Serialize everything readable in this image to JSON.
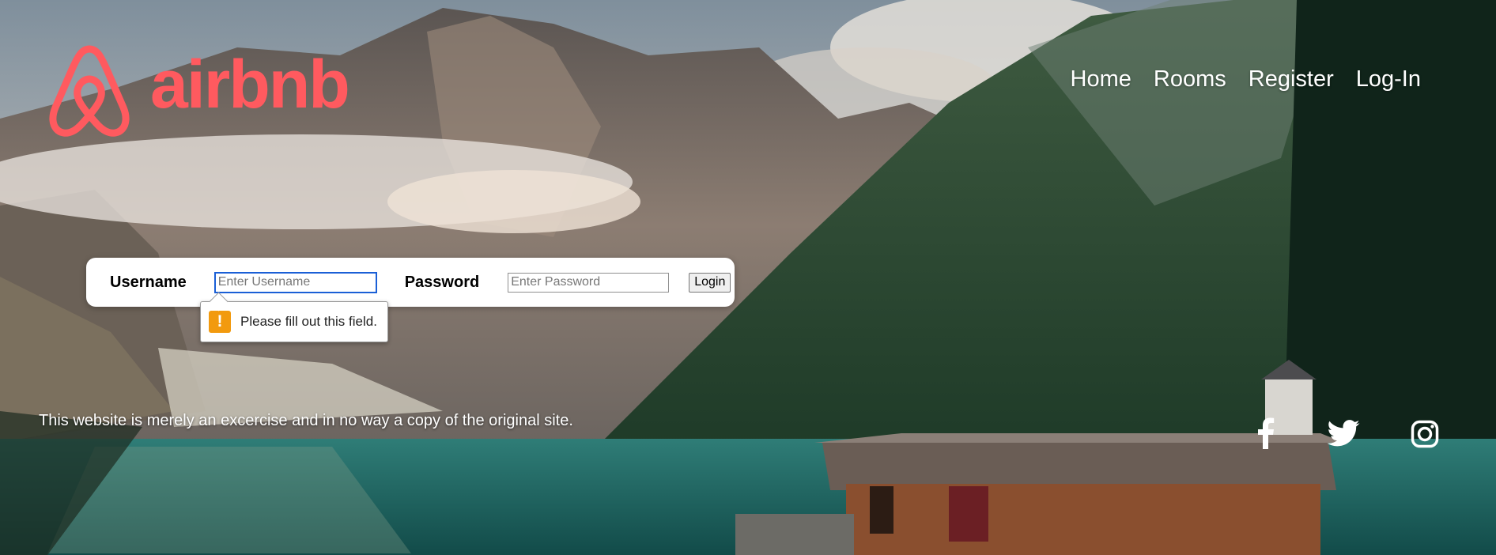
{
  "brand": {
    "name": "airbnb",
    "color": "#ff5a5f"
  },
  "nav": {
    "items": [
      "Home",
      "Rooms",
      "Register",
      "Log-In"
    ]
  },
  "login": {
    "username_label": "Username",
    "username_placeholder": "Enter Username",
    "password_label": "Password",
    "password_placeholder": "Enter Password",
    "button_label": "Login"
  },
  "validation": {
    "message": "Please fill out this field.",
    "icon": "warning-icon"
  },
  "footer": {
    "disclaimer": "This website is merely an excercise and in no way a copy of the original site.",
    "social_icons": [
      "facebook-icon",
      "twitter-icon",
      "instagram-icon"
    ]
  }
}
